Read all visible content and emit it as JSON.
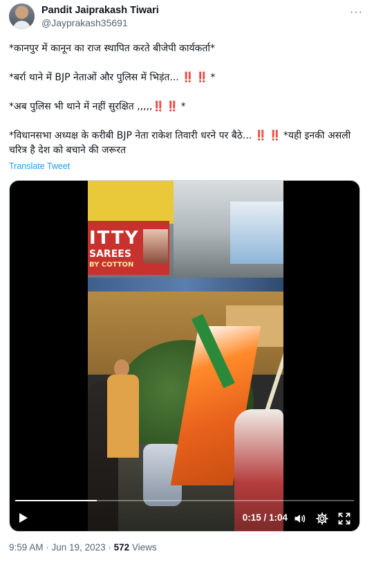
{
  "author": {
    "name": "Pandit Jaiprakash Tiwari",
    "handle": "@Jayprakash35691",
    "avatar_icon": "user-avatar"
  },
  "more_icon": "more-options-icon",
  "tweet": {
    "line1": "*कानपुर में कानून का राज स्थापित करते बीजेपी कार्यकर्ता*",
    "line2_text": "*बर्रा थाने में BJP नेताओं और पुलिस में भिड़ंत... ",
    "line2_em": "‼️ ‼️",
    "line2_end": " *",
    "line3_text": "*अब पुलिस भी थाने में नहीं सुरक्षित ,,,,,",
    "line3_em": "‼️ ‼️",
    "line3_end": " *",
    "line4_text": "*विधानसभा अध्यक्ष के करीबी BJP नेता राकेश तिवारी धरने पर बैठे... ",
    "line4_em": "‼️ ‼️",
    "line4_end": " *यही इनकी असली चरित्र है देश को बचाने की जरूरत",
    "translate_label": "Translate Tweet"
  },
  "video": {
    "shop_sign_text": "ITTY",
    "shop_sign_sub": "SAREES",
    "shop_sign_sub2": "BY COTTON",
    "progress_fraction": 0.24,
    "time_display": "0:15 / 1:04",
    "play_icon": "play-icon",
    "volume_icon": "volume-icon",
    "settings_icon": "gear-icon",
    "fullscreen_icon": "fullscreen-icon"
  },
  "meta": {
    "time": "9:59 AM",
    "separator": " · ",
    "date": "Jun 19, 2023",
    "views_count": "572",
    "views_label": "Views"
  },
  "colors": {
    "link": "#1d9bf0",
    "emphasis": "#c8102e",
    "secondary_text": "#536471"
  }
}
